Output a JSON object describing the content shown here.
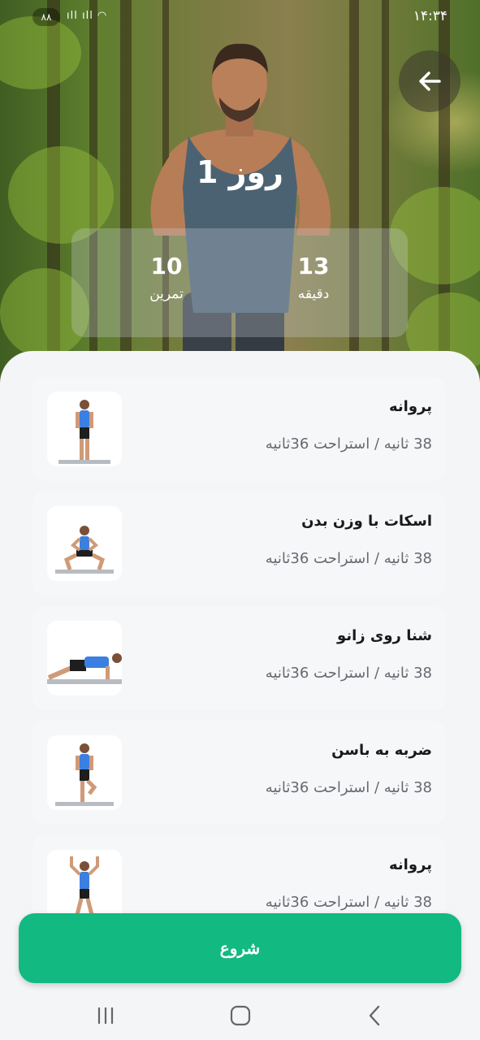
{
  "status_bar": {
    "time": "۱۴:۳۴",
    "battery": "۸۸",
    "signal": "ıll ıll ◠"
  },
  "header": {
    "day_title": "روز 1"
  },
  "stats": {
    "minutes_value": "13",
    "minutes_label": "دقیقه",
    "exercises_value": "10",
    "exercises_label": "تمرین"
  },
  "exercises": [
    {
      "name": "پروانه",
      "meta": "38 ثانیه / استراحت 36ثانیه"
    },
    {
      "name": "اسکات با وزن بدن",
      "meta": "38 ثانیه / استراحت 36ثانیه"
    },
    {
      "name": "شنا روی زانو",
      "meta": "38 ثانیه / استراحت 36ثانیه"
    },
    {
      "name": "ضربه به باسن",
      "meta": "38 ثانیه / استراحت 36ثانیه"
    },
    {
      "name": "پروانه",
      "meta": "38 ثانیه / استراحت 36ثانیه"
    }
  ],
  "start_button": {
    "label": "شروع"
  },
  "colors": {
    "accent": "#12b981",
    "sheet_bg": "#f4f5f7"
  },
  "icons": [
    "arrow-left-icon",
    "recent-apps-icon",
    "home-icon",
    "back-nav-icon"
  ]
}
